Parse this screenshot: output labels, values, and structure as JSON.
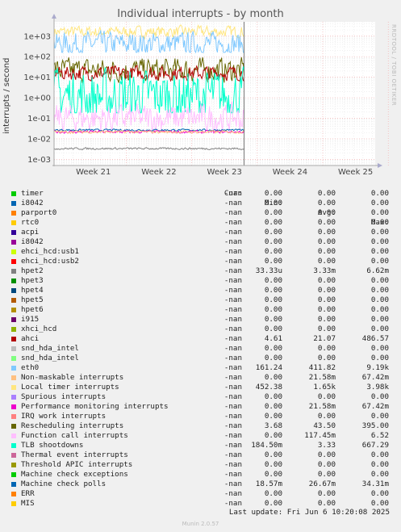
{
  "title": "Individual interrupts - by month",
  "watermark": "RRDTOOL / TOBI OETIKER",
  "ylabel": "interrupts / second",
  "columns": {
    "cur": "Cur:",
    "min": "Min:",
    "avg": "Avg:",
    "max": "Max:"
  },
  "legend": [
    {
      "name": "timer",
      "color": "#00cc00",
      "cur": "-nan",
      "min": "0.00",
      "avg": "0.00",
      "max": "0.00"
    },
    {
      "name": "i8042",
      "color": "#0066b3",
      "cur": "-nan",
      "min": "0.00",
      "avg": "0.00",
      "max": "0.00"
    },
    {
      "name": "parport0",
      "color": "#ff8000",
      "cur": "-nan",
      "min": "0.00",
      "avg": "0.00",
      "max": "0.00"
    },
    {
      "name": "rtc0",
      "color": "#ffcc00",
      "cur": "-nan",
      "min": "0.00",
      "avg": "0.00",
      "max": "0.00"
    },
    {
      "name": "acpi",
      "color": "#330099",
      "cur": "-nan",
      "min": "0.00",
      "avg": "0.00",
      "max": "0.00"
    },
    {
      "name": "i8042",
      "color": "#990099",
      "cur": "-nan",
      "min": "0.00",
      "avg": "0.00",
      "max": "0.00"
    },
    {
      "name": "ehci_hcd:usb1",
      "color": "#ccff00",
      "cur": "-nan",
      "min": "0.00",
      "avg": "0.00",
      "max": "0.00"
    },
    {
      "name": "ehci_hcd:usb2",
      "color": "#ff0000",
      "cur": "-nan",
      "min": "0.00",
      "avg": "0.00",
      "max": "0.00"
    },
    {
      "name": "hpet2",
      "color": "#808080",
      "cur": "-nan",
      "min": "33.33u",
      "avg": "3.33m",
      "max": "6.62m"
    },
    {
      "name": "hpet3",
      "color": "#008f00",
      "cur": "-nan",
      "min": "0.00",
      "avg": "0.00",
      "max": "0.00"
    },
    {
      "name": "hpet4",
      "color": "#00487d",
      "cur": "-nan",
      "min": "0.00",
      "avg": "0.00",
      "max": "0.00"
    },
    {
      "name": "hpet5",
      "color": "#b35a00",
      "cur": "-nan",
      "min": "0.00",
      "avg": "0.00",
      "max": "0.00"
    },
    {
      "name": "hpet6",
      "color": "#b38f00",
      "cur": "-nan",
      "min": "0.00",
      "avg": "0.00",
      "max": "0.00"
    },
    {
      "name": "i915",
      "color": "#6b006b",
      "cur": "-nan",
      "min": "0.00",
      "avg": "0.00",
      "max": "0.00"
    },
    {
      "name": "xhci_hcd",
      "color": "#8fb300",
      "cur": "-nan",
      "min": "0.00",
      "avg": "0.00",
      "max": "0.00"
    },
    {
      "name": "ahci",
      "color": "#b30000",
      "cur": "-nan",
      "min": "4.61",
      "avg": "21.07",
      "max": "486.57"
    },
    {
      "name": "snd_hda_intel",
      "color": "#bebebe",
      "cur": "-nan",
      "min": "0.00",
      "avg": "0.00",
      "max": "0.00"
    },
    {
      "name": "snd_hda_intel",
      "color": "#80ff80",
      "cur": "-nan",
      "min": "0.00",
      "avg": "0.00",
      "max": "0.00"
    },
    {
      "name": "eth0",
      "color": "#80c9ff",
      "cur": "-nan",
      "min": "161.24",
      "avg": "411.82",
      "max": "9.19k"
    },
    {
      "name": "Non-maskable interrupts",
      "color": "#ffc080",
      "cur": "-nan",
      "min": "0.00",
      "avg": "21.58m",
      "max": "67.42m"
    },
    {
      "name": "Local timer interrupts",
      "color": "#ffe680",
      "cur": "-nan",
      "min": "452.38",
      "avg": "1.65k",
      "max": "3.98k"
    },
    {
      "name": "Spurious interrupts",
      "color": "#aa80ff",
      "cur": "-nan",
      "min": "0.00",
      "avg": "0.00",
      "max": "0.00"
    },
    {
      "name": "Performance monitoring interrupts",
      "color": "#ee00cc",
      "cur": "-nan",
      "min": "0.00",
      "avg": "21.58m",
      "max": "67.42m"
    },
    {
      "name": "IRQ work interrupts",
      "color": "#ff8080",
      "cur": "-nan",
      "min": "0.00",
      "avg": "0.00",
      "max": "0.00"
    },
    {
      "name": "Rescheduling interrupts",
      "color": "#666600",
      "cur": "-nan",
      "min": "3.68",
      "avg": "43.50",
      "max": "395.00"
    },
    {
      "name": "Function call interrupts",
      "color": "#ffbfff",
      "cur": "-nan",
      "min": "0.00",
      "avg": "117.45m",
      "max": "6.52"
    },
    {
      "name": "TLB shootdowns",
      "color": "#00ffcc",
      "cur": "-nan",
      "min": "184.50m",
      "avg": "3.33",
      "max": "667.29"
    },
    {
      "name": "Thermal event interrupts",
      "color": "#cc6699",
      "cur": "-nan",
      "min": "0.00",
      "avg": "0.00",
      "max": "0.00"
    },
    {
      "name": "Threshold APIC interrupts",
      "color": "#999900",
      "cur": "-nan",
      "min": "0.00",
      "avg": "0.00",
      "max": "0.00"
    },
    {
      "name": "Machine check exceptions",
      "color": "#00cc00",
      "cur": "-nan",
      "min": "0.00",
      "avg": "0.00",
      "max": "0.00"
    },
    {
      "name": "Machine check polls",
      "color": "#0066b3",
      "cur": "-nan",
      "min": "18.57m",
      "avg": "26.67m",
      "max": "34.31m"
    },
    {
      "name": "ERR",
      "color": "#ff8000",
      "cur": "-nan",
      "min": "0.00",
      "avg": "0.00",
      "max": "0.00"
    },
    {
      "name": "MIS",
      "color": "#ffcc00",
      "cur": "-nan",
      "min": "0.00",
      "avg": "0.00",
      "max": "0.00"
    }
  ],
  "last_update": "Last update: Fri Jun  6 10:20:08 2025",
  "footer": "Munin 2.0.57",
  "chart_data": {
    "type": "line",
    "title": "Individual interrupts - by month",
    "ylabel": "interrupts / second",
    "y_scale": "log",
    "ylim": [
      0.0005,
      5000
    ],
    "y_ticks": [
      "1e-03",
      "1e-02",
      "1e-01",
      "1e+00",
      "1e+01",
      "1e+02",
      "1e+03"
    ],
    "x_ticks": [
      "Week 21",
      "Week 22",
      "Week 23",
      "Week 24",
      "Week 25"
    ],
    "x_range_weeks": [
      20.4,
      25.3
    ],
    "data_end_week": 23.3,
    "grid": true,
    "series": [
      {
        "name": "Local timer interrupts",
        "color": "#ffe680",
        "level": 1650,
        "lo": 452.38,
        "hi": 3980,
        "noise": 0.12
      },
      {
        "name": "eth0",
        "color": "#80c9ff",
        "level": 411.82,
        "lo": 161.24,
        "hi": 9190,
        "noise": 0.25
      },
      {
        "name": "Rescheduling interrupts",
        "color": "#666600",
        "level": 22,
        "lo": 3.68,
        "hi": 395,
        "noise": 0.25
      },
      {
        "name": "ahci",
        "color": "#b30000",
        "level": 16,
        "lo": 4.61,
        "hi": 486.57,
        "noise": 0.15
      },
      {
        "name": "TLB shootdowns",
        "color": "#00ffcc",
        "level": 1.2,
        "lo": 0.1845,
        "hi": 667.29,
        "noise": 0.55
      },
      {
        "name": "Function call interrupts",
        "color": "#ffbfff",
        "level": 0.1,
        "lo": 0.001,
        "hi": 6.52,
        "noise": 0.3
      },
      {
        "name": "Machine check polls",
        "color": "#0066b3",
        "level": 0.0267,
        "lo": 0.01857,
        "hi": 0.03431,
        "noise": 0.02
      },
      {
        "name": "Performance monitoring interrupts",
        "color": "#ee00cc",
        "level": 0.0216,
        "lo": 0.0,
        "hi": 0.06742,
        "noise": 0.03
      },
      {
        "name": "Non-maskable interrupts",
        "color": "#ffc080",
        "level": 0.0216,
        "lo": 0.0,
        "hi": 0.06742,
        "noise": 0.03
      },
      {
        "name": "hpet2",
        "color": "#808080",
        "level": 0.00333,
        "lo": 3.33e-05,
        "hi": 0.00662,
        "noise": 0.02
      }
    ]
  }
}
